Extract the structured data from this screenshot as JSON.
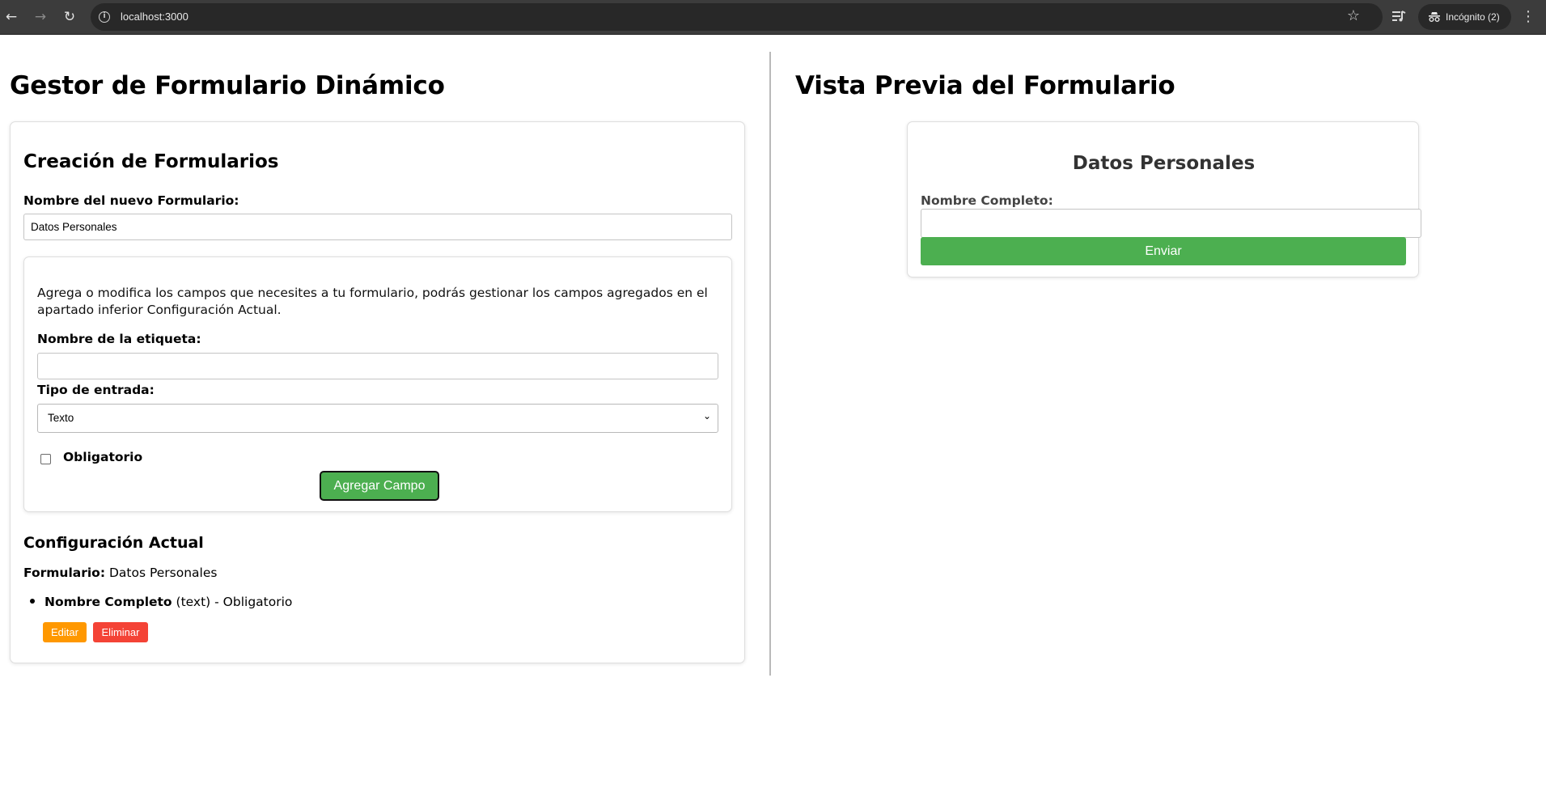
{
  "browser": {
    "url": "localhost:3000",
    "incognito_label": "Incógnito (2)"
  },
  "builder": {
    "title": "Gestor de Formulario Dinámico",
    "creation": {
      "title": "Creación de Formularios",
      "form_name_label": "Nombre del nuevo Formulario:",
      "form_name_value": "Datos Personales",
      "help_text": "Agrega o modifica los campos que necesites a tu formulario, podrás gestionar los campos agregados en el apartado inferior Configuración Actual.",
      "tag_label": "Nombre de la etiqueta:",
      "tag_value": "",
      "type_label": "Tipo de entrada:",
      "type_value": "Texto",
      "required_label": "Obligatorio",
      "required_checked": false,
      "add_button": "Agregar Campo"
    },
    "config": {
      "title": "Configuración Actual",
      "form_label": "Formulario:",
      "form_name": "Datos Personales",
      "fields": [
        {
          "name": "Nombre Completo",
          "type": "(text)",
          "required": "- Obligatorio",
          "edit_label": "Editar",
          "delete_label": "Eliminar"
        }
      ]
    }
  },
  "preview": {
    "title": "Vista Previa del Formulario",
    "form_title": "Datos Personales",
    "field_label": "Nombre Completo:",
    "field_value": "",
    "submit_label": "Enviar"
  },
  "colors": {
    "primary_green": "#4caf50",
    "edit_orange": "#ff9800",
    "delete_red": "#f44336"
  }
}
